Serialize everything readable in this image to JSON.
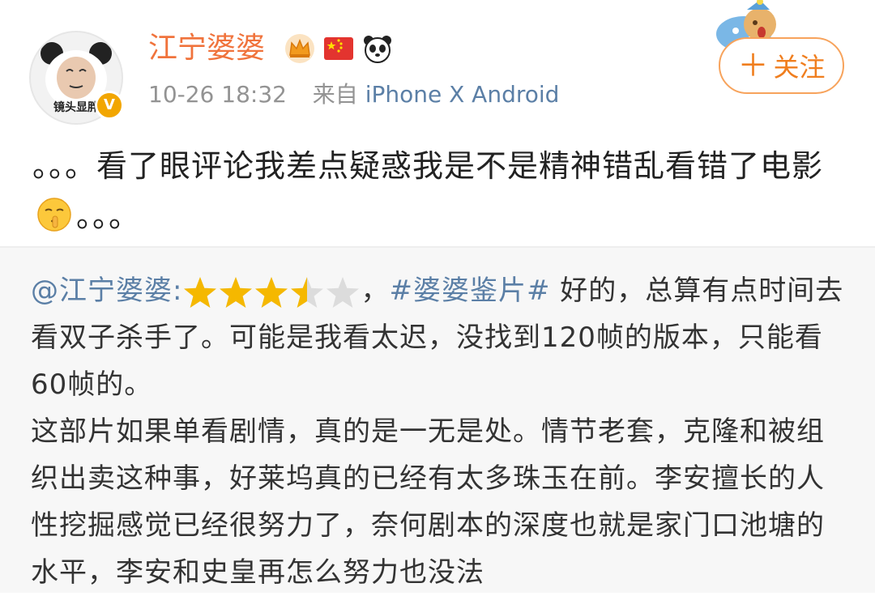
{
  "post": {
    "username": "江宁婆婆",
    "avatar_caption": "镜头显胖",
    "badges": [
      "crown-icon",
      "china-flag-icon",
      "panda-icon"
    ],
    "verified_badge": "V",
    "timestamp": "10-26 18:32",
    "source_prefix": "来自",
    "source": "iPhone X Android",
    "follow_label": "关注",
    "text_part1": "。。。看了眼评论我差点疑惑我是不是精神错乱看错了电影",
    "text_part2": "。。。",
    "emoji": "shush-face-emoji"
  },
  "repost": {
    "mention": "@江宁婆婆",
    "mention_colon": ":",
    "rating": {
      "value": 3.5,
      "max": 5
    },
    "comma": "，",
    "hashtag": "#婆婆鉴片#",
    "line1": " 好的，总算有点时间去看双子杀手了。可能是我看太迟，没找到120帧的版本，只能看60帧的。",
    "paragraph2": "这部片如果单看剧情，真的是一无是处。情节老套，克隆和被组织出卖这种事，好莱坞真的已经有太多珠玉在前。李安擅长的人性挖掘感觉已经很努力了，奈何剧本的深度也就是家门口池塘的水平，李安和史皇再怎么努力也没法"
  },
  "colors": {
    "username": "#f0733c",
    "link": "#5b7fa6",
    "star": "#f5b800",
    "follow_border": "#f7a35c"
  }
}
